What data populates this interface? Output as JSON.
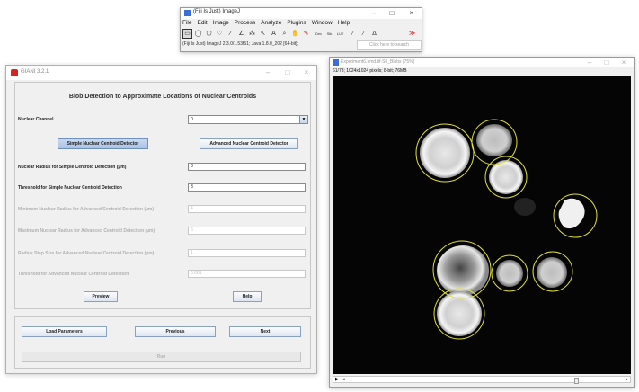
{
  "imagej": {
    "title": "(Fiji Is Just) ImageJ",
    "menu": [
      "File",
      "Edit",
      "Image",
      "Process",
      "Analyze",
      "Plugins",
      "Window",
      "Help"
    ],
    "tools": [
      "▭",
      "◯",
      "⬠",
      "♡",
      "⁄",
      "∠",
      "⁂",
      "↖",
      "A",
      "⌕",
      "✋",
      "✎",
      "Dev",
      "Stk",
      "LUT",
      "⁄",
      "⁄",
      "∆",
      "≫"
    ],
    "status": "(Fiji Is Just) ImageJ 2.3.0/1.53f51; Java 1.8.0_202 [64-bit];",
    "search_placeholder": "Click here to search"
  },
  "giani": {
    "title": "GIANI 3.2.1",
    "heading": "Blob Detection to Approximate Locations of Nuclear Centroids",
    "nuclear_channel_label": "Nuclear Channel",
    "nuclear_channel_value": "0",
    "simple_button": "Simple Nuclear Centroid Detector",
    "advanced_button": "Advanced Nuclear Centroid Detector",
    "radius_simple_label": "Nuclear Radius for Simple Centroid Detection (µm)",
    "radius_simple_value": "8",
    "threshold_simple_label": "Threshold for Simple Nuclear Centroid Detection",
    "threshold_simple_value": "3",
    "min_radius_label": "Minimum Nuclear Radius for Advanced Centroid Detection (µm)",
    "min_radius_value": "4",
    "max_radius_label": "Maximum Nuclear Radius for Advanced Centroid Detection (µm)",
    "max_radius_value": "6",
    "step_label": "Radius Step Size for Advanced Nuclear Centroid Detection (µm)",
    "step_value": "1",
    "threshold_adv_label": "Threshold for Advanced Nuclear Centroid Detection",
    "threshold_adv_value": "0.001",
    "preview_button": "Preview",
    "help_button": "Help",
    "load_button": "Load Parameters",
    "previous_button": "Previous",
    "next_button": "Next",
    "run_button": "Run"
  },
  "image_window": {
    "title": "Experiment6.nmd.tif-S0_Blobs (75%)",
    "info": "61/78; 1024x1024 pixels; 8-bit; 76MB"
  },
  "colors": {
    "detection_circle": "#e0e03a",
    "nucleus": "#f2f2f2",
    "selected_button": "#a9c2e6"
  }
}
